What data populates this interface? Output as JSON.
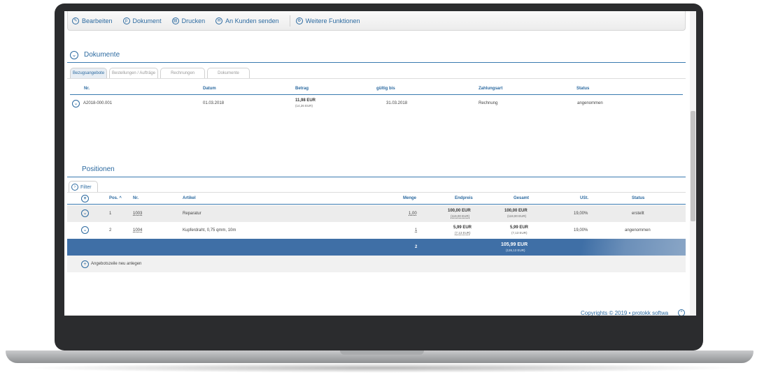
{
  "toolbar": {
    "edit_label": "Bearbeiten",
    "document_label": "Dokument",
    "print_label": "Drucken",
    "send_label": "An Kunden senden",
    "more_label": "Weitere Funktionen"
  },
  "documents": {
    "title": "Dokumente",
    "tabs": [
      "Bezugsangebote",
      "Bestellungen / Aufträge",
      "Rechnungen",
      "Dokumente"
    ],
    "columns": [
      "Nr.",
      "Datum",
      "Betrag",
      "gültig bis",
      "Zahlungsart",
      "Status"
    ],
    "rows": [
      {
        "nr": "A2018-000.001",
        "datum": "01.03.2018",
        "betrag": "11,98 EUR",
        "betrag_brutto": "(14,26 EUR)",
        "gueltig_bis": "31.03.2018",
        "zahlungsart": "Rechnung",
        "status": "angenommen"
      }
    ]
  },
  "positions": {
    "title": "Positionen",
    "filter_label": "Filter",
    "columns": [
      "Pos.",
      "Nr.",
      "Artikel",
      "Menge",
      "Endpreis",
      "Gesamt",
      "USt.",
      "Status"
    ],
    "rows": [
      {
        "pos": "1",
        "nr": "1003",
        "artikel": "Reparatur",
        "menge": "1,00",
        "endpreis": "100,00 EUR",
        "endpreis_brutto": "(119,00 EUR)",
        "gesamt": "100,00 EUR",
        "gesamt_brutto": "(119,00 EUR)",
        "ust": "19,00%",
        "status": "erstellt"
      },
      {
        "pos": "2",
        "nr": "1004",
        "artikel": "Kupferdraht, 0,75 qmm, 10m",
        "menge": "1",
        "endpreis": "5,99 EUR",
        "endpreis_brutto": "(7,13 EUR)",
        "gesamt": "5,99 EUR",
        "gesamt_brutto": "(7,13 EUR)",
        "ust": "19,00%",
        "status": "angenommen"
      }
    ],
    "summary": {
      "menge": "2",
      "gesamt": "105,99 EUR",
      "gesamt_brutto": "(126,13 EUR)"
    },
    "new_line_label": "Angebotszeile neu anlegen"
  },
  "footer": {
    "copyright": "Copyrights © 2019 • protokk softwa"
  },
  "icons": {
    "edit": "pencil-icon",
    "document": "pdf-icon",
    "print": "printer-icon",
    "send": "mail-icon",
    "more": "gear-icon",
    "expand": "chevron-down-icon",
    "add": "plus-icon",
    "filter": "chevron-right-icon",
    "scroll_top": "chevron-up-icon"
  },
  "colors": {
    "accent": "#2c6aa0",
    "summary_bar": "#3f6fa6",
    "frame": "#2b2c2e"
  }
}
